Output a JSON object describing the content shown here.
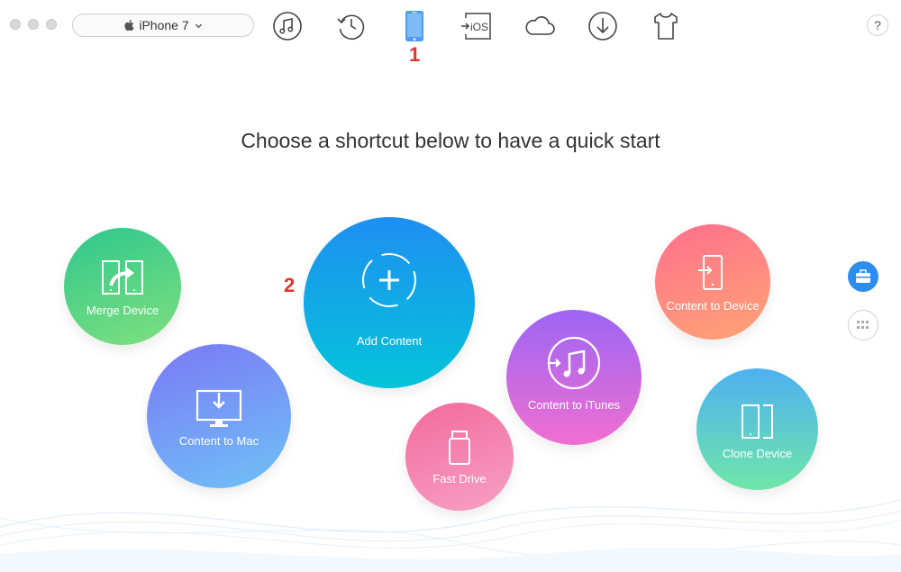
{
  "toolbar": {
    "device_name": "iPhone 7",
    "tabs": [
      {
        "icon": "music-note-icon"
      },
      {
        "icon": "history-icon"
      },
      {
        "icon": "iphone-icon",
        "active": true
      },
      {
        "icon": "ios-transfer-icon",
        "label": "iOS"
      },
      {
        "icon": "cloud-icon"
      },
      {
        "icon": "download-icon"
      },
      {
        "icon": "shirt-icon"
      }
    ],
    "help_label": "?"
  },
  "markers": {
    "one": "1",
    "two": "2"
  },
  "main": {
    "heading": "Choose a shortcut below to have a quick start",
    "shortcuts": {
      "merge_device": "Merge Device",
      "add_content": "Add Content",
      "content_to_mac": "Content to Mac",
      "fast_drive": "Fast Drive",
      "content_to_itunes": "Content to iTunes",
      "content_to_device": "Content to Device",
      "clone_device": "Clone Device"
    }
  },
  "colors": {
    "accent_blue": "#2d8cf0",
    "marker_red": "#e0332b"
  }
}
